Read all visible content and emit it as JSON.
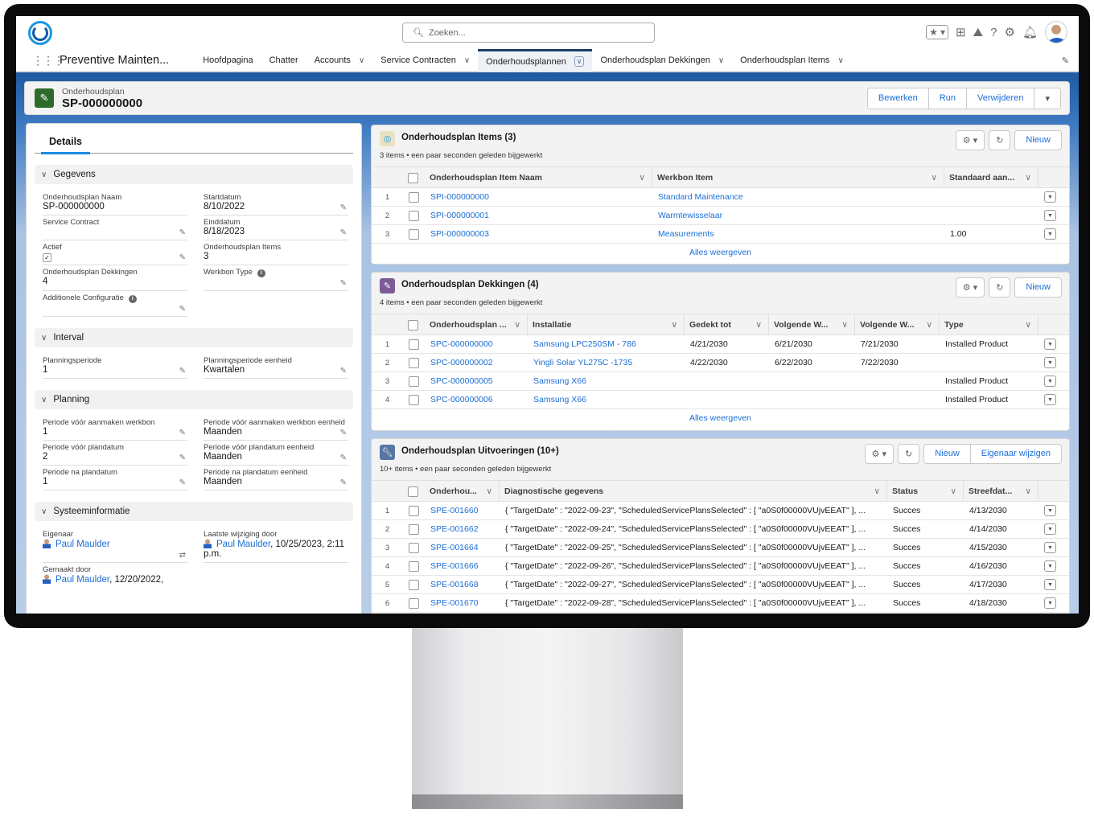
{
  "header": {
    "search_placeholder": "Zoeken...",
    "app_name": "Preventive Mainten..."
  },
  "nav": [
    {
      "label": "Hoofdpagina",
      "menu": false
    },
    {
      "label": "Chatter",
      "menu": false
    },
    {
      "label": "Accounts",
      "menu": true
    },
    {
      "label": "Service Contracten",
      "menu": true
    },
    {
      "label": "Onderhoudsplannen",
      "menu": true,
      "active": true
    },
    {
      "label": "Onderhoudsplan Dekkingen",
      "menu": true
    },
    {
      "label": "Onderhoudsplan Items",
      "menu": true
    }
  ],
  "record": {
    "type": "Onderhoudsplan",
    "title": "SP-000000000",
    "actions": [
      "Bewerken",
      "Run",
      "Verwijderen"
    ]
  },
  "details": {
    "tab": "Details",
    "sections": [
      {
        "title": "Gegevens",
        "fields": [
          {
            "label": "Onderhoudsplan Naam",
            "value": "SP-000000000",
            "edit": false
          },
          {
            "label": "Startdatum",
            "value": "8/10/2022",
            "edit": true
          },
          {
            "label": "Service Contract",
            "value": "",
            "edit": true
          },
          {
            "label": "Einddatum",
            "value": "8/18/2023",
            "edit": true
          },
          {
            "label": "Actief",
            "checkbox": true,
            "checked": true,
            "edit": true
          },
          {
            "label": "Onderhoudsplan Items",
            "value": "3",
            "edit": false
          },
          {
            "label": "Onderhoudsplan Dekkingen",
            "value": "4",
            "edit": false
          },
          {
            "label": "Werkbon Type",
            "value": "",
            "edit": true,
            "info": true
          },
          {
            "label": "Additionele Configuratie",
            "value": "",
            "edit": true,
            "info": true
          }
        ]
      },
      {
        "title": "Interval",
        "fields": [
          {
            "label": "Planningsperiode",
            "value": "1",
            "edit": true
          },
          {
            "label": "Planningsperiode eenheid",
            "value": "Kwartalen",
            "edit": true
          }
        ]
      },
      {
        "title": "Planning",
        "fields": [
          {
            "label": "Periode vóór aanmaken werkbon",
            "value": "1",
            "edit": true
          },
          {
            "label": "Periode vóór aanmaken werkbon eenheid",
            "value": "Maanden",
            "edit": true
          },
          {
            "label": "Periode vóór plandatum",
            "value": "2",
            "edit": true
          },
          {
            "label": "Periode vóór plandatum eenheid",
            "value": "Maanden",
            "edit": true
          },
          {
            "label": "Periode na plandatum",
            "value": "1",
            "edit": true
          },
          {
            "label": "Periode na plandatum eenheid",
            "value": "Maanden",
            "edit": true
          }
        ]
      },
      {
        "title": "Systeeminformatie",
        "fields": [
          {
            "label": "Eigenaar",
            "user": "Paul Maulder",
            "suffix": "",
            "owner_change": true
          },
          {
            "label": "Laatste wijziging door",
            "user": "Paul Maulder",
            "suffix": ", 10/25/2023, 2:11 p.m."
          },
          {
            "label": "Gemaakt door",
            "user": "Paul Maulder",
            "suffix": ", 12/20/2022,"
          }
        ]
      }
    ]
  },
  "related": [
    {
      "title": "Onderhoudsplan Items (3)",
      "subtitle": "3 items • een paar seconden geleden bijgewerkt",
      "icon": "service-plan-icon",
      "icon_color": "#e9e2c4",
      "buttons": [
        "Nieuw"
      ],
      "columns": [
        "Onderhoudsplan Item Naam",
        "Werkbon Item",
        "Standaard aan..."
      ],
      "rows": [
        [
          "SPI-000000000",
          "Standard Maintenance",
          ""
        ],
        [
          "SPI-000000001",
          "Warmtewisselaar",
          ""
        ],
        [
          "SPI-000000003",
          "Measurements",
          "1.00"
        ]
      ],
      "link_cols": [
        0,
        1
      ],
      "view_all": "Alles weergeven"
    },
    {
      "title": "Onderhoudsplan Dekkingen (4)",
      "subtitle": "4 items • een paar seconden geleden bijgewerkt",
      "icon": "asset-wrench-icon",
      "icon_color": "#7c5b96",
      "buttons": [
        "Nieuw"
      ],
      "columns": [
        "Onderhoudsplan ...",
        "Installatie",
        "Gedekt tot",
        "Volgende W...",
        "Volgende W...",
        "Type"
      ],
      "rows": [
        [
          "SPC-000000000",
          "Samsung LPC250SM - 786",
          "4/21/2030",
          "6/21/2030",
          "7/21/2030",
          "Installed Product"
        ],
        [
          "SPC-000000002",
          "Yingli Solar YL275C -1735",
          "4/22/2030",
          "6/22/2030",
          "7/22/2030",
          ""
        ],
        [
          "SPC-000000005",
          "Samsung X66",
          "",
          "",
          "",
          "Installed Product"
        ],
        [
          "SPC-000000006",
          "Samsung X66",
          "",
          "",
          "",
          "Installed Product"
        ]
      ],
      "link_cols": [
        0,
        1
      ],
      "view_all": "Alles weergeven"
    },
    {
      "title": "Onderhoudsplan Uitvoeringen (10+)",
      "subtitle": "10+ items • een paar seconden geleden bijgewerkt",
      "icon": "wrench-icon",
      "icon_color": "#5876a3",
      "buttons": [
        "Nieuw",
        "Eigenaar wijzigen"
      ],
      "columns": [
        "Onderhou...",
        "Diagnostische gegevens",
        "Status",
        "Streefdat..."
      ],
      "rows": [
        [
          "SPE-001660",
          "{ \"TargetDate\" : \"2022-09-23\", \"ScheduledServicePlansSelected\" : [ \"a0S0f00000VUjvEEAT\" ], ...",
          "Succes",
          "4/13/2030"
        ],
        [
          "SPE-001662",
          "{ \"TargetDate\" : \"2022-09-24\", \"ScheduledServicePlansSelected\" : [ \"a0S0f00000VUjvEEAT\" ], ...",
          "Succes",
          "4/14/2030"
        ],
        [
          "SPE-001664",
          "{ \"TargetDate\" : \"2022-09-25\", \"ScheduledServicePlansSelected\" : [ \"a0S0f00000VUjvEEAT\" ], ...",
          "Succes",
          "4/15/2030"
        ],
        [
          "SPE-001666",
          "{ \"TargetDate\" : \"2022-09-26\", \"ScheduledServicePlansSelected\" : [ \"a0S0f00000VUjvEEAT\" ], ...",
          "Succes",
          "4/16/2030"
        ],
        [
          "SPE-001668",
          "{ \"TargetDate\" : \"2022-09-27\", \"ScheduledServicePlansSelected\" : [ \"a0S0f00000VUjvEEAT\" ], ...",
          "Succes",
          "4/17/2030"
        ],
        [
          "SPE-001670",
          "{ \"TargetDate\" : \"2022-09-28\", \"ScheduledServicePlansSelected\" : [ \"a0S0f00000VUjvEEAT\" ], ...",
          "Succes",
          "4/18/2030"
        ]
      ],
      "link_cols": [
        0
      ]
    }
  ],
  "colors": {
    "brand": "#1b96e0",
    "link": "#1b6ed6",
    "record_icon": "#2e6b2b",
    "nav_active": "#1b3e66"
  }
}
